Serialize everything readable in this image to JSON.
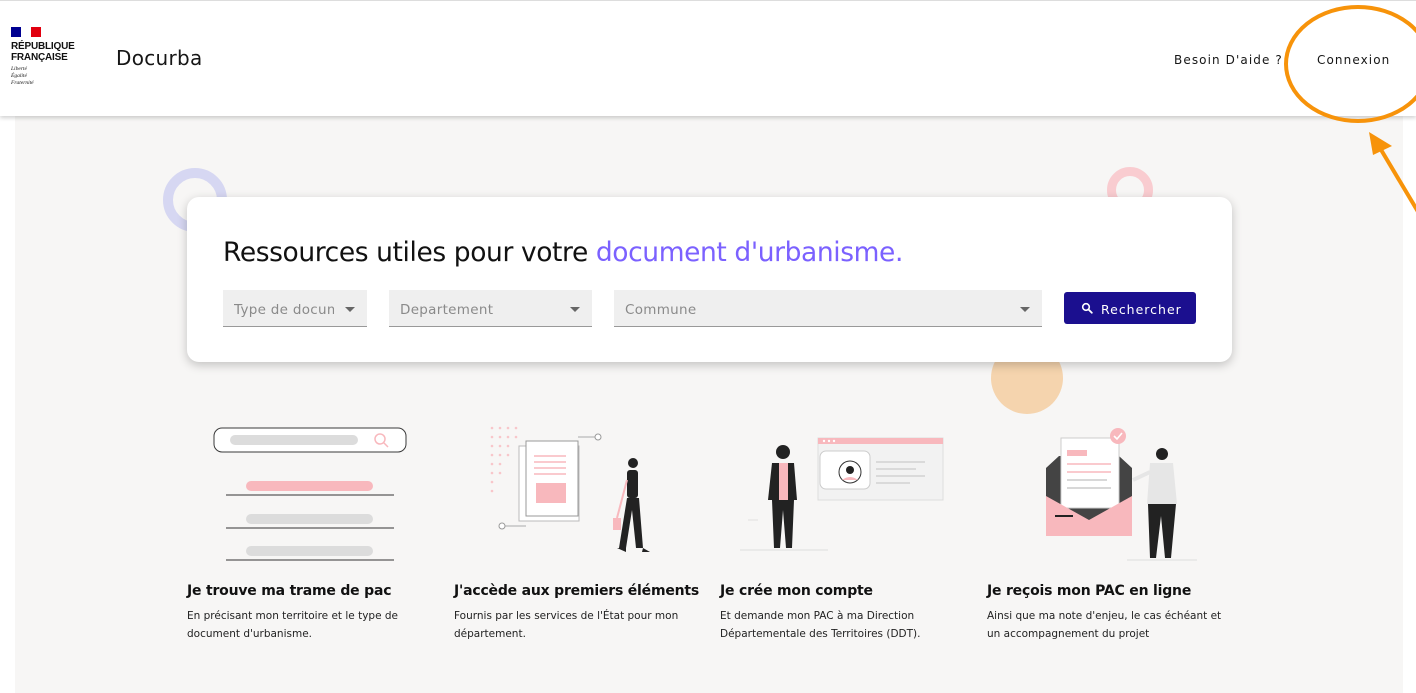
{
  "header": {
    "logo_name": "RÉPUBLIQUE\nFRANÇAISE",
    "logo_motto": "Liberté\nÉgalité\nFraternité",
    "site_title": "Docurba",
    "help_link": "Besoin D'aide ?",
    "login_link": "Connexion"
  },
  "colors": {
    "flag_blue": "#000091",
    "flag_red": "#e1000f",
    "accent": "#7b61ff",
    "button": "#1b0f8f",
    "pink": "#f8b8bd",
    "annotation": "#f7930a"
  },
  "search": {
    "title_main": "Ressources utiles pour votre ",
    "title_accent": "document d'urbanisme.",
    "type_placeholder": "Type de docum",
    "departement_placeholder": "Departement",
    "commune_placeholder": "Commune",
    "button_label": "Rechercher",
    "button_icon": "search-icon"
  },
  "features": [
    {
      "title": "Je trouve ma trame de pac",
      "description": "En précisant mon territoire et le type de document d'urbanisme.",
      "illustration": "search-list-illustration"
    },
    {
      "title": "J'accède aux premiers éléments",
      "description": "Fournis par les services de l'État pour mon département.",
      "illustration": "document-woman-illustration"
    },
    {
      "title": "Je crée mon compte",
      "description": "Et demande mon PAC à ma Direction Départementale des Territoires (DDT).",
      "illustration": "account-man-illustration"
    },
    {
      "title": "Je reçois mon PAC en ligne",
      "description": "Ainsi que ma note d'enjeu, le cas échéant et un accompagnement du projet",
      "illustration": "envelope-man-illustration"
    }
  ]
}
